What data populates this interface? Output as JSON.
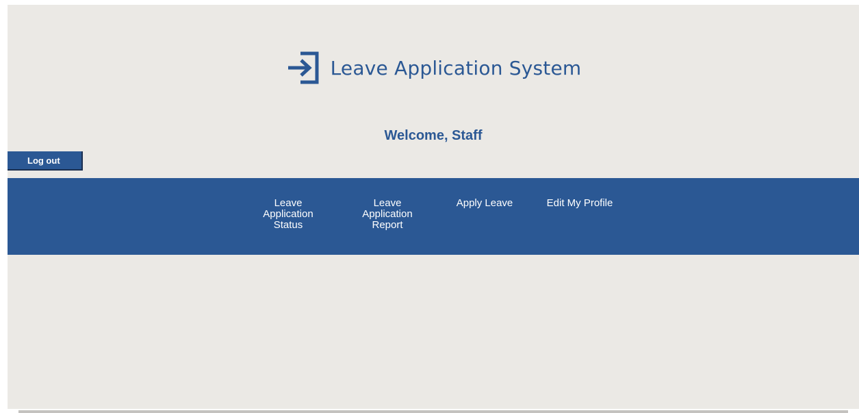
{
  "app": {
    "title": "Leave Application System",
    "logo_icon": "login-arrow-icon",
    "brand_color": "#2b5894",
    "background_color": "#ebe9e5"
  },
  "welcome_text": "Welcome, Staff",
  "logout_label": "Log out",
  "nav": {
    "items": [
      {
        "label": "Leave Application Status"
      },
      {
        "label": "Leave Application Report"
      },
      {
        "label": "Apply Leave"
      },
      {
        "label": "Edit My Profile"
      }
    ]
  }
}
